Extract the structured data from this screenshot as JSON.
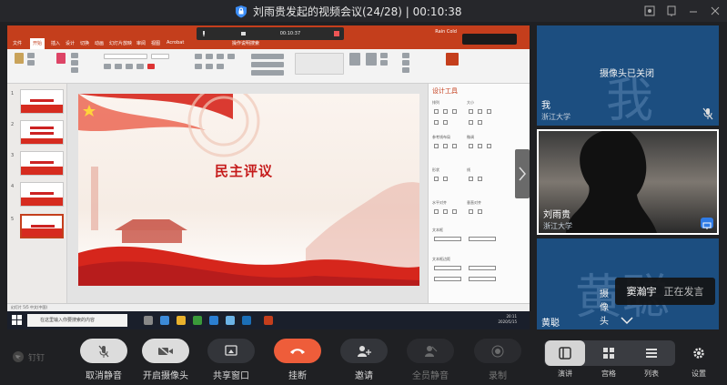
{
  "window": {
    "title": "刘雨贵发起的视频会议(24/28) | 00:10:38"
  },
  "shared_screen": {
    "ppt": {
      "tabs": [
        "文件",
        "开始",
        "插入",
        "设计",
        "切换",
        "动画",
        "幻灯片放映",
        "审阅",
        "视图",
        "Acrobat",
        "操作说明搜索"
      ],
      "active_tab": "开始",
      "user": "Rain Cold",
      "recording_timer": "00:10:37",
      "slide_title": "民主评议",
      "slide_numbers": [
        "1",
        "2",
        "3",
        "4",
        "5"
      ],
      "design_pane": {
        "title": "设计工具",
        "labels": [
          "排列",
          "大小",
          "参考线布局",
          "微调",
          "形状",
          "线",
          "水平对齐",
          "垂直对齐",
          "文本框",
          "文本框边距"
        ]
      },
      "status_bar": "幻灯片 5/5  中文(中国)",
      "taskbar": {
        "search_placeholder": "在这里输入你要搜索的内容",
        "clock_time": "20:11",
        "clock_date": "2020/5/15"
      }
    }
  },
  "participants": [
    {
      "name": "我",
      "org": "浙江大学",
      "avatar_char": "我",
      "camera_status": "摄像头已关闭",
      "mic": "muted"
    },
    {
      "name": "刘雨贵",
      "org": "浙江大学",
      "sharing": true
    },
    {
      "name": "黄聪",
      "avatar_char": "黄聪",
      "camera_status": "摄像头已关闭"
    }
  ],
  "speaking_toast": {
    "name": "窦瀚宇",
    "status": "正在发言"
  },
  "toolbar": {
    "brand": "钉钉",
    "buttons": [
      {
        "id": "unmute",
        "label": "取消静音"
      },
      {
        "id": "camera",
        "label": "开启摄像头"
      },
      {
        "id": "share",
        "label": "共享窗口"
      },
      {
        "id": "hangup",
        "label": "挂断"
      },
      {
        "id": "invite",
        "label": "邀请"
      },
      {
        "id": "mute_all",
        "label": "全员静音"
      },
      {
        "id": "record",
        "label": "录制"
      }
    ],
    "views": [
      {
        "id": "speaker",
        "label": "演讲"
      },
      {
        "id": "gallery",
        "label": "宫格"
      },
      {
        "id": "list",
        "label": "列表"
      }
    ],
    "settings_label": "设置"
  },
  "colors": {
    "hangup": "#ee5d3a",
    "tile_blue": "#1c4e80",
    "ppt_accent": "#c43e1c",
    "share_badge": "#2f7be5"
  }
}
